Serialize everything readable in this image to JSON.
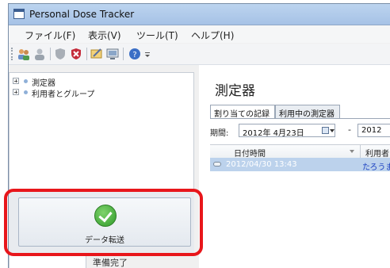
{
  "window": {
    "title": "Personal Dose Tracker"
  },
  "menu": [
    "ファイル(F)",
    "表示(V)",
    "ツール(T)",
    "ヘルプ(H)"
  ],
  "toolbar": {
    "icons": [
      "users-icon",
      "user-icon",
      "shield-icon",
      "shield-x-icon",
      "edit-icon",
      "monitor-icon",
      "help-icon"
    ]
  },
  "tree": {
    "items": [
      "測定器",
      "利用者とグループ"
    ]
  },
  "transfer_button": {
    "label": "データ転送"
  },
  "status": {
    "text": "準備完了"
  },
  "main": {
    "title": "測定器",
    "tabs": [
      "割り当ての記録",
      "利用中の測定器"
    ],
    "period_label": "期間:",
    "date_from": "2012年 4月23日",
    "dash": "-",
    "date_to": "2012",
    "columns": [
      "日付時間",
      "利用者"
    ],
    "rows": [
      {
        "datetime": "2012/04/30 13:43",
        "user": "たろうまる"
      }
    ]
  },
  "colors": {
    "highlight_frame": "#e8161b",
    "selected_row": "#bcd2ec",
    "user_link": "#1a3fc0"
  }
}
